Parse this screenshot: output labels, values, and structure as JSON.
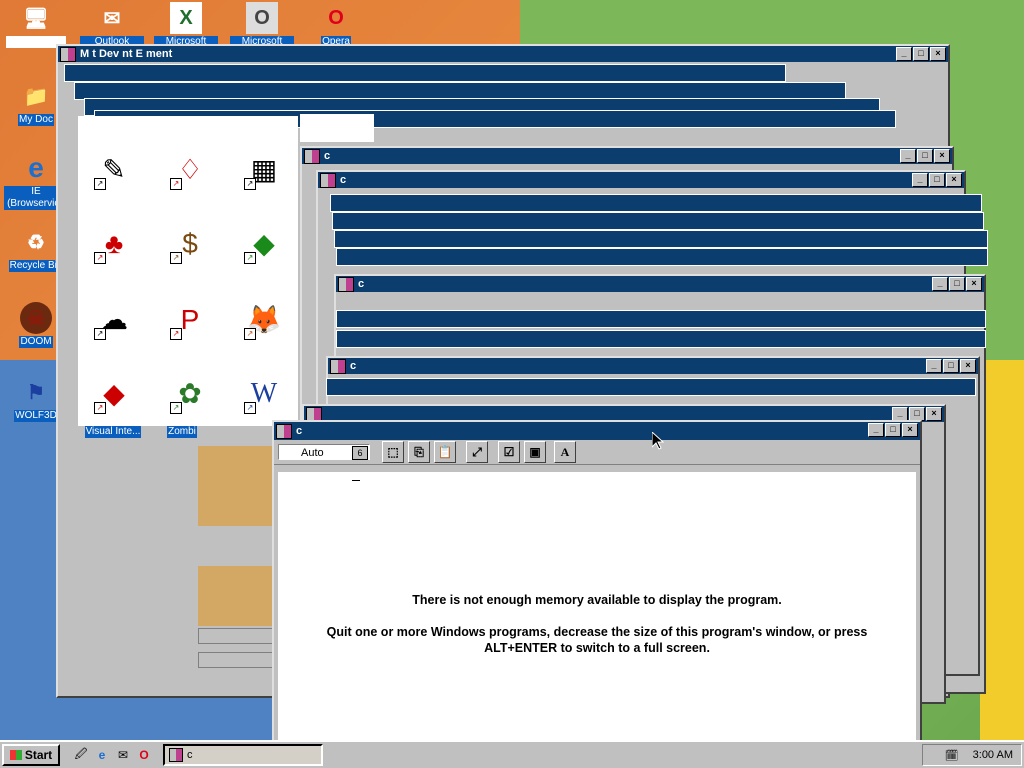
{
  "desktop": {
    "icons": [
      {
        "label": "",
        "glyph": "🖥"
      },
      {
        "label": "Outlook Express",
        "glyph": "✉"
      },
      {
        "label": "Microsoft Excel",
        "glyph": "X"
      },
      {
        "label": "Microsoft Outlook",
        "glyph": "O"
      },
      {
        "label": "Opera",
        "glyph": "O"
      },
      {
        "label": "My Doc",
        "glyph": "📁"
      },
      {
        "label": "IE (Browservice",
        "glyph": "e"
      },
      {
        "label": "Recycle Bin",
        "glyph": "♻"
      },
      {
        "label": "DOOM",
        "glyph": "☠"
      },
      {
        "label": "WOLF3D",
        "glyph": "⚑"
      },
      {
        "label": "Visual Inte...",
        "glyph": "◆"
      },
      {
        "label": "Zombi",
        "glyph": "✿"
      }
    ]
  },
  "background_window": {
    "title": "M     t Dev      nt E       ment"
  },
  "stacked_window_title": "c",
  "dos_window": {
    "title": "c",
    "font_select": "Auto",
    "font_select_arrow": "6",
    "message_line1": "There is not enough memory available to display the program.",
    "message_line2": "Quit one or more Windows programs, decrease the size of this program's window, or press ALT+ENTER to switch to a full screen."
  },
  "taskbar": {
    "start_label": "Start",
    "task_label": "c",
    "clock": "3:00 AM"
  },
  "colors": {
    "titlebar": "#0b3d6e",
    "face": "#c0c0c0",
    "desktop_orange": "#e07a36"
  }
}
